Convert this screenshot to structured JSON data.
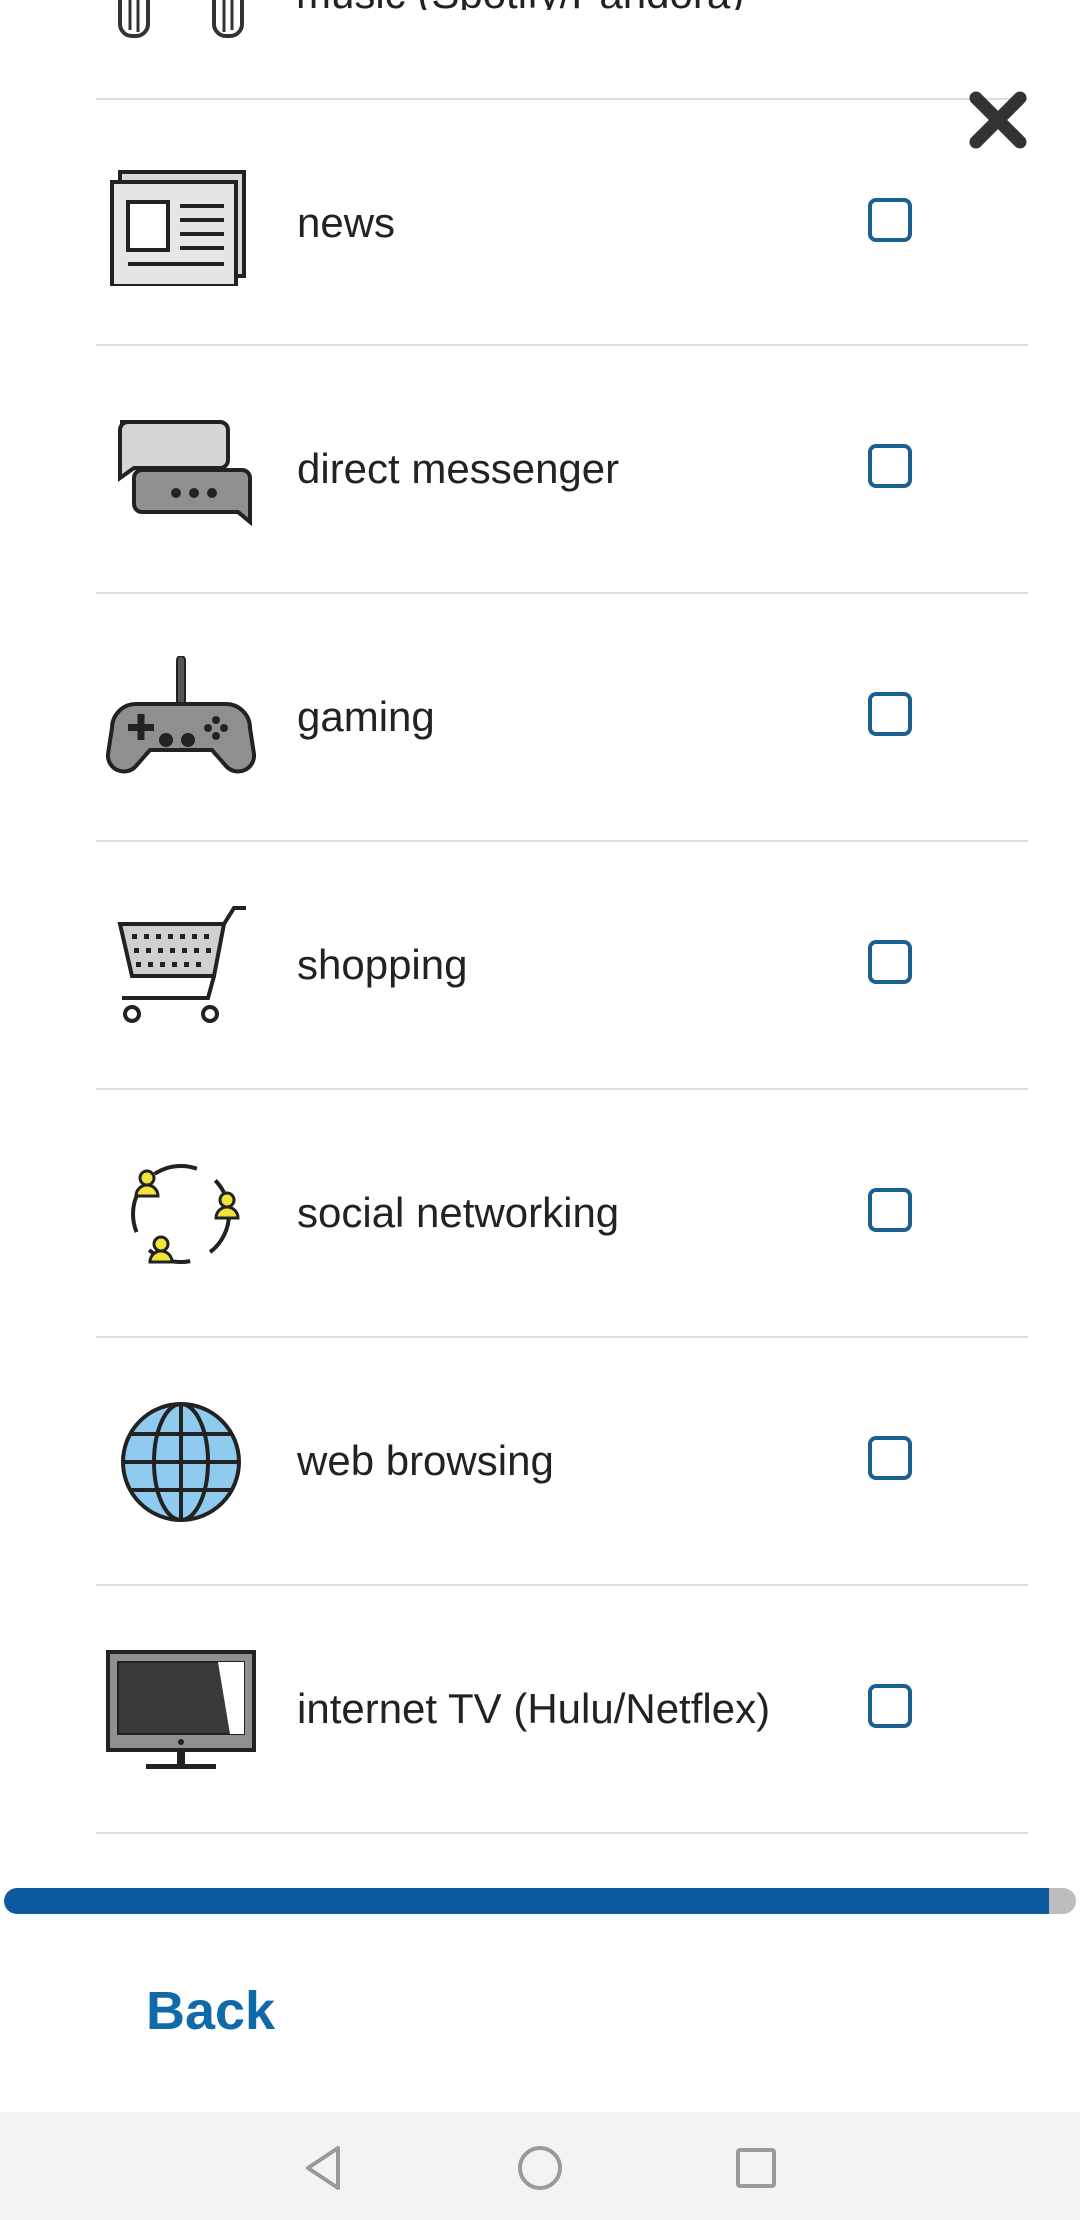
{
  "colors": {
    "accent": "#0f6aa7",
    "checkbox_border": "#1a5f8f",
    "progress_fill": "#0d5aa0",
    "progress_track": "#bdbdbd",
    "divider": "#dddddd"
  },
  "top_partial": {
    "icon": "headphones-icon",
    "label": "music (Spotify/Pandora)"
  },
  "close": {
    "icon": "close-icon"
  },
  "items": [
    {
      "label": "news",
      "icon": "newspaper-icon",
      "checked": false
    },
    {
      "label": "direct messenger",
      "icon": "chat-bubbles-icon",
      "checked": false
    },
    {
      "label": "gaming",
      "icon": "gamepad-icon",
      "checked": false
    },
    {
      "label": "shopping",
      "icon": "shopping-cart-icon",
      "checked": false
    },
    {
      "label": "social networking",
      "icon": "social-network-icon",
      "checked": false
    },
    {
      "label": "web browsing",
      "icon": "globe-icon",
      "checked": false
    },
    {
      "label": "internet TV (Hulu/Netflex)",
      "icon": "tv-icon",
      "checked": false
    }
  ],
  "progress": {
    "value": 0.975
  },
  "footer": {
    "back_label": "Back"
  },
  "navbar": {
    "back_icon": "nav-back-icon",
    "home_icon": "nav-home-icon",
    "recents_icon": "nav-recents-icon"
  }
}
